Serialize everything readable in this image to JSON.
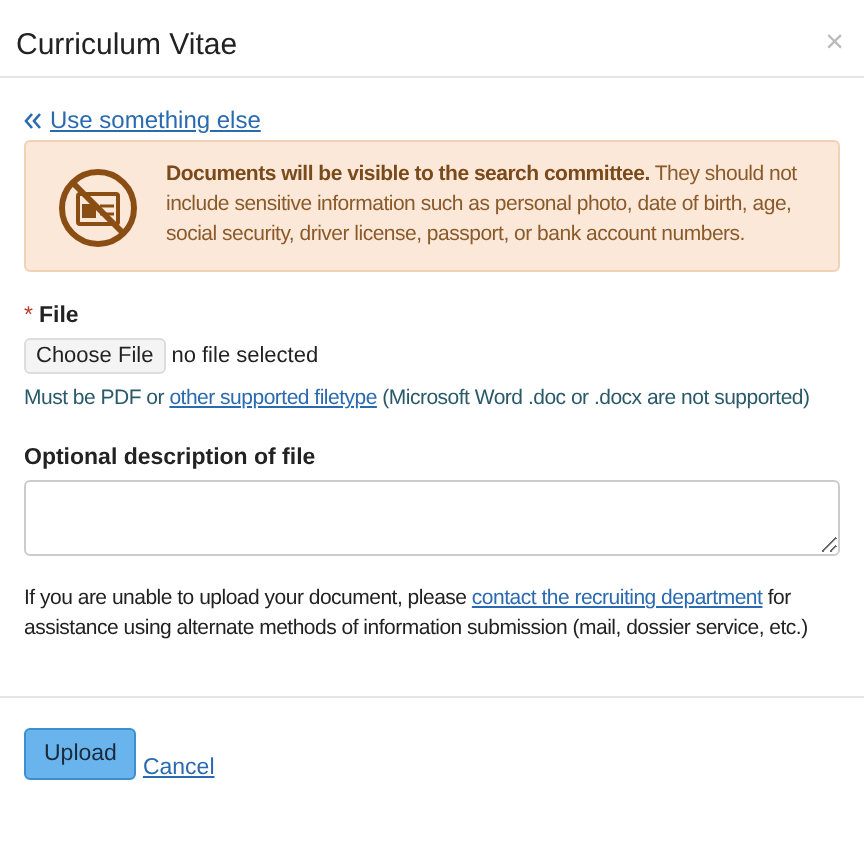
{
  "dialog": {
    "title": "Curriculum Vitae",
    "close": "×"
  },
  "back_link": "Use something else",
  "warning": {
    "bold": "Documents will be visible to the search committee.",
    "text": " They should not include sensitive information such as personal photo, date of birth, age, social security, driver license, passport, or bank account numbers."
  },
  "file_field": {
    "required_mark": "*",
    "label": "File",
    "button": "Choose File",
    "status": "no file selected",
    "help_before": "Must be PDF or ",
    "help_link": "other supported filetype",
    "help_after": " (Microsoft Word .doc or .docx are not supported)"
  },
  "description_field": {
    "label": "Optional description of file"
  },
  "note": {
    "before": "If you are unable to upload your document, please ",
    "link": "contact the recruiting department",
    "after": " for assistance using alternate methods of information submission (mail, dossier service, etc.)"
  },
  "buttons": [
    {
      "kind": "primary",
      "label": "Upload"
    },
    {
      "kind": "link",
      "label": "Cancel"
    }
  ]
}
